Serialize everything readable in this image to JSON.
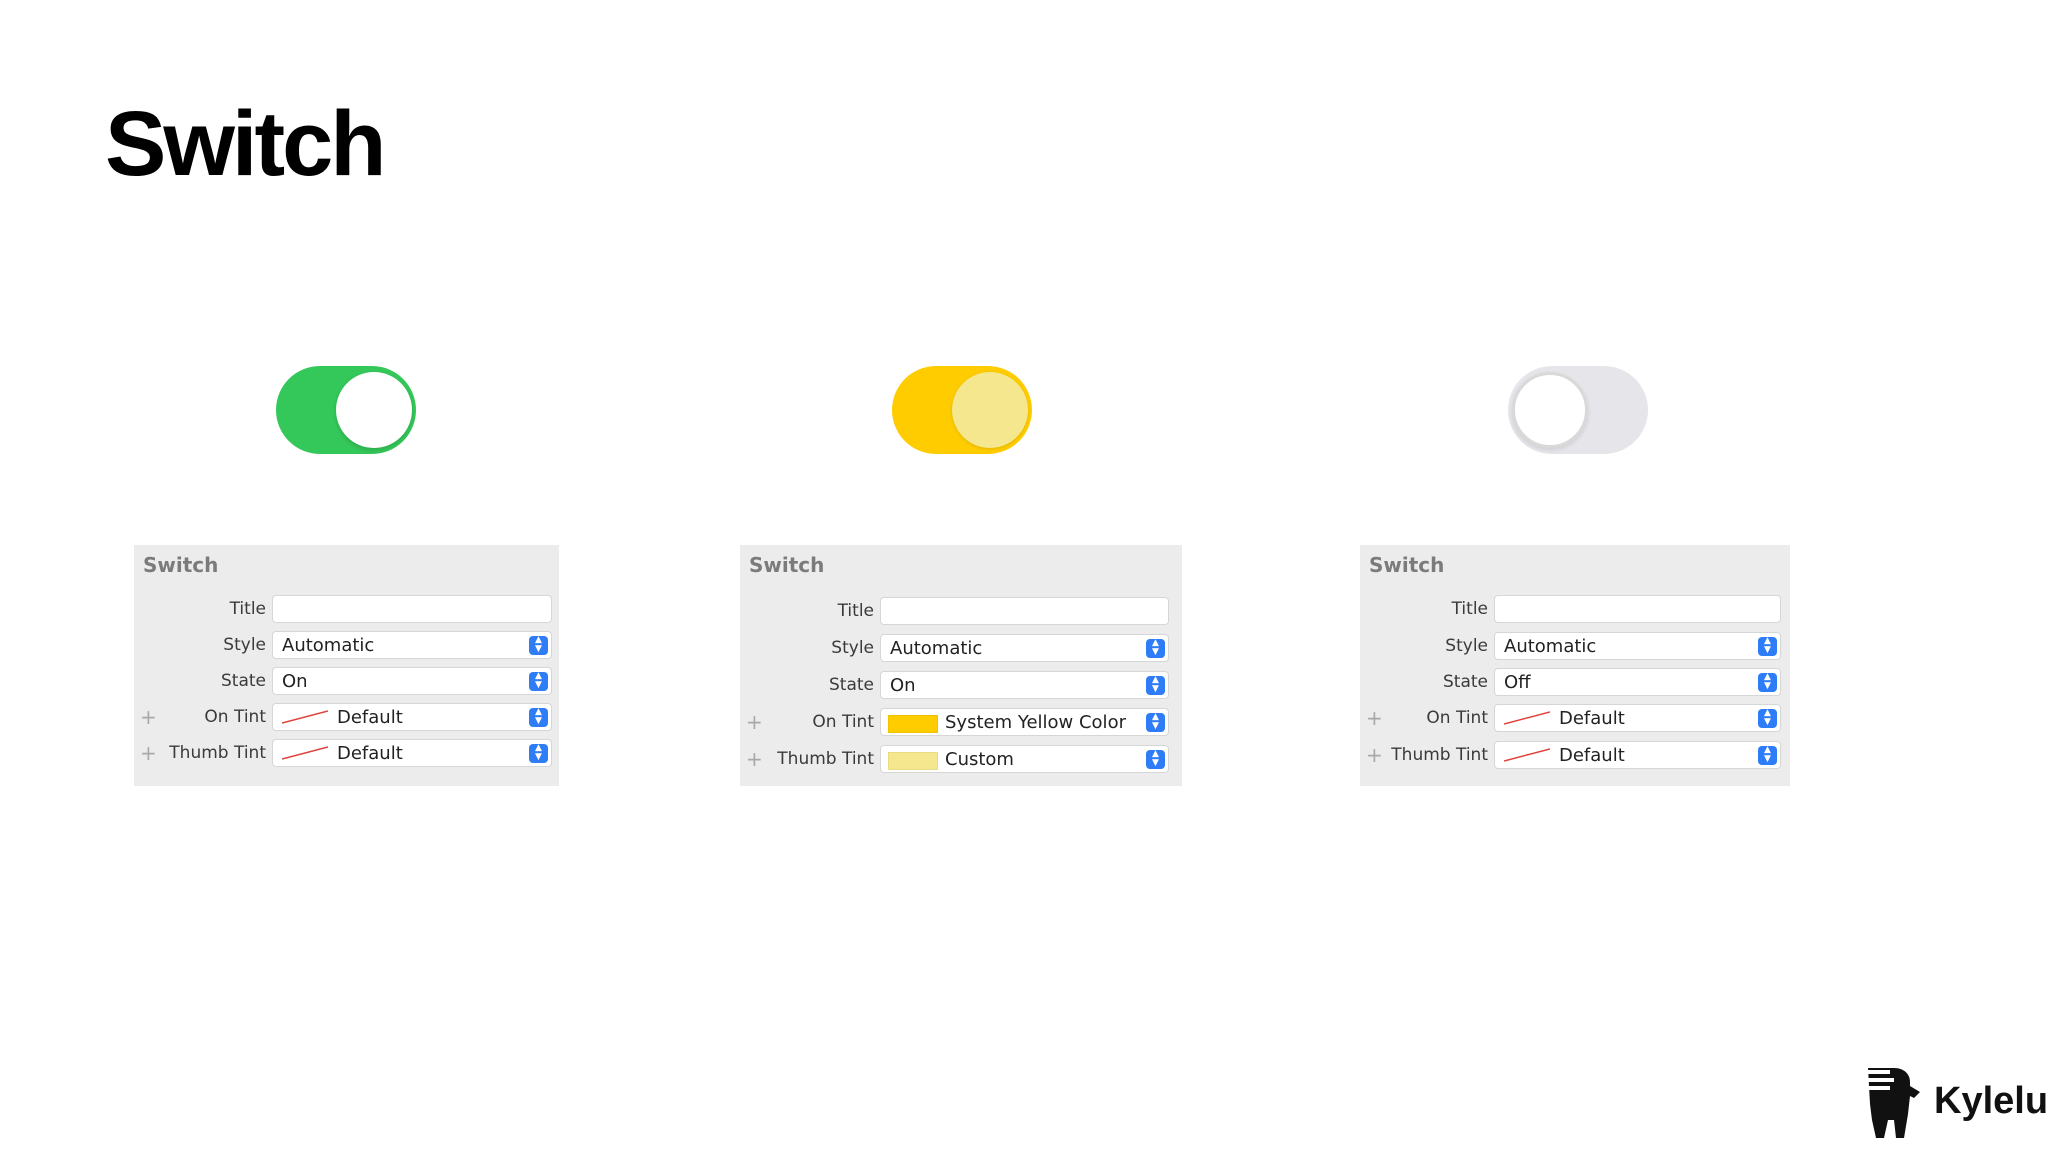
{
  "page": {
    "title": "Switch"
  },
  "switches": [
    {
      "name": "switch-green-on",
      "state": "on",
      "track_color": "#34c759",
      "thumb_color": "#ffffff"
    },
    {
      "name": "switch-yellow-on",
      "state": "on",
      "track_color": "#ffcc00",
      "thumb_color": "#f4e78d"
    },
    {
      "name": "switch-off",
      "state": "off",
      "track_color": "#e5e5ea",
      "thumb_color": "#ffffff"
    }
  ],
  "panels": [
    {
      "header": "Switch",
      "labels": {
        "title": "Title",
        "style": "Style",
        "state": "State",
        "on_tint": "On Tint",
        "thumb_tint": "Thumb Tint"
      },
      "values": {
        "title": "",
        "style": "Automatic",
        "state": "On",
        "on_tint": "Default",
        "thumb_tint": "Default"
      }
    },
    {
      "header": "Switch",
      "labels": {
        "title": "Title",
        "style": "Style",
        "state": "State",
        "on_tint": "On Tint",
        "thumb_tint": "Thumb Tint"
      },
      "values": {
        "title": "",
        "style": "Automatic",
        "state": "On",
        "on_tint": "System Yellow Color",
        "thumb_tint": "Custom"
      },
      "swatch_colors": {
        "on_tint": "#ffcc00",
        "thumb_tint": "#f4e78d"
      }
    },
    {
      "header": "Switch",
      "labels": {
        "title": "Title",
        "style": "Style",
        "state": "State",
        "on_tint": "On Tint",
        "thumb_tint": "Thumb Tint"
      },
      "values": {
        "title": "",
        "style": "Automatic",
        "state": "Off",
        "on_tint": "Default",
        "thumb_tint": "Default"
      }
    }
  ],
  "icons": {
    "plus": "+",
    "stepper_up": "▲",
    "stepper_down": "▼"
  },
  "brand": {
    "name": "Kylelu"
  }
}
